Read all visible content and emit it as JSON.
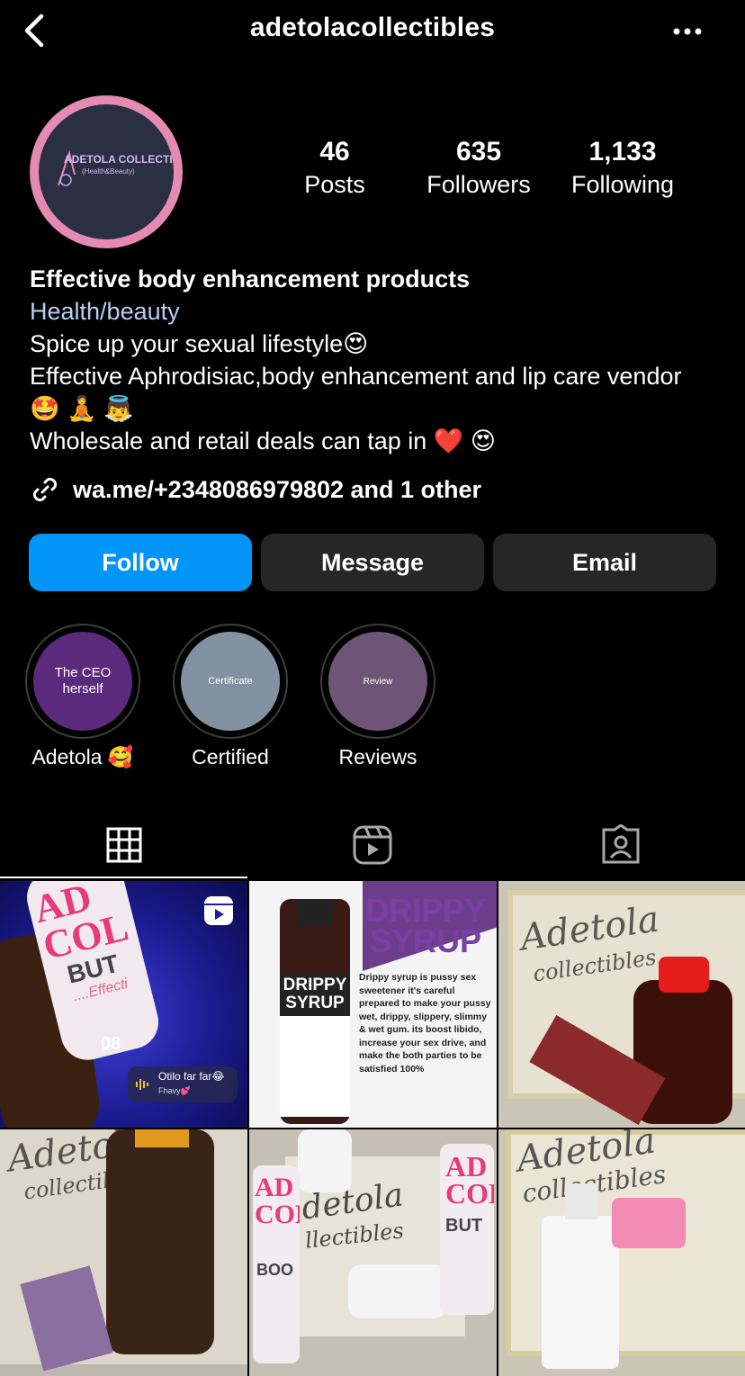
{
  "header": {
    "username": "adetolacollectibles",
    "back_icon": "chevron-left-icon",
    "more_icon": "ellipsis-icon"
  },
  "avatar": {
    "logo_text": "ADETOLA COLLECTIBLES",
    "logo_sub": "(Health&Beauty)"
  },
  "stats": [
    {
      "value": "46",
      "label": "Posts"
    },
    {
      "value": "635",
      "label": "Followers"
    },
    {
      "value": "1,133",
      "label": "Following"
    }
  ],
  "bio": {
    "name": "Effective body enhancement products",
    "category": "Health/beauty",
    "lines": [
      "Spice up your sexual lifestyle😍",
      "Effective Aphrodisiac,body enhancement and lip care vendor 🤩 🧘 👼",
      "Wholesale and retail deals can tap in ❤️ 😍"
    ],
    "link": "wa.me/+2348086979802 and 1 other"
  },
  "buttons": {
    "follow": "Follow",
    "message": "Message",
    "email": "Email"
  },
  "highlights": [
    {
      "cover_text": "The CEO herself",
      "label": "Adetola 🥰",
      "color": "#5b2a7c"
    },
    {
      "cover_text": "Certificate",
      "label": "Certified",
      "color": "#8292a3"
    },
    {
      "cover_text": "Review",
      "label": "Reviews",
      "color": "#6e5577"
    }
  ],
  "tabs": [
    {
      "icon": "grid-icon",
      "active": true
    },
    {
      "icon": "reels-icon",
      "active": false
    },
    {
      "icon": "tagged-icon",
      "active": false
    }
  ],
  "posts": [
    {
      "texts": {
        "bottle_a": "AD",
        "bottle_b": "COL",
        "bottle_c": "BUT",
        "bottle_d": "....Effecti",
        "num": "08",
        "sticker_title": "Otilo far far😂",
        "sticker_sub": "Fhavy💕"
      }
    },
    {
      "texts": {
        "title1": "DRIPPY",
        "title2": "SYRUP",
        "label1": "DRIPPY",
        "label2": "SYRUP",
        "desc": "Drippy syrup is pussy sex sweetener it's careful prepared to make your pussy wet, drippy, slippery, slimmy & wet gum. its boost libido, increase your sex drive, and make the both parties to be satisfied 100%"
      }
    },
    {
      "texts": {
        "brand1": "Adetola",
        "brand2": "collectibles"
      }
    },
    {
      "texts": {
        "brand1": "Adetola",
        "brand2": "collectibl"
      }
    },
    {
      "texts": {
        "brand1": "detola",
        "brand2": "llectibles",
        "l1": "AD",
        "l2": "COL",
        "l3": "BOO",
        "r1": "AD",
        "r2": "COL",
        "r3": "BUT"
      }
    },
    {
      "texts": {
        "brand1": "Adetola",
        "brand2": "collectibles"
      }
    }
  ]
}
